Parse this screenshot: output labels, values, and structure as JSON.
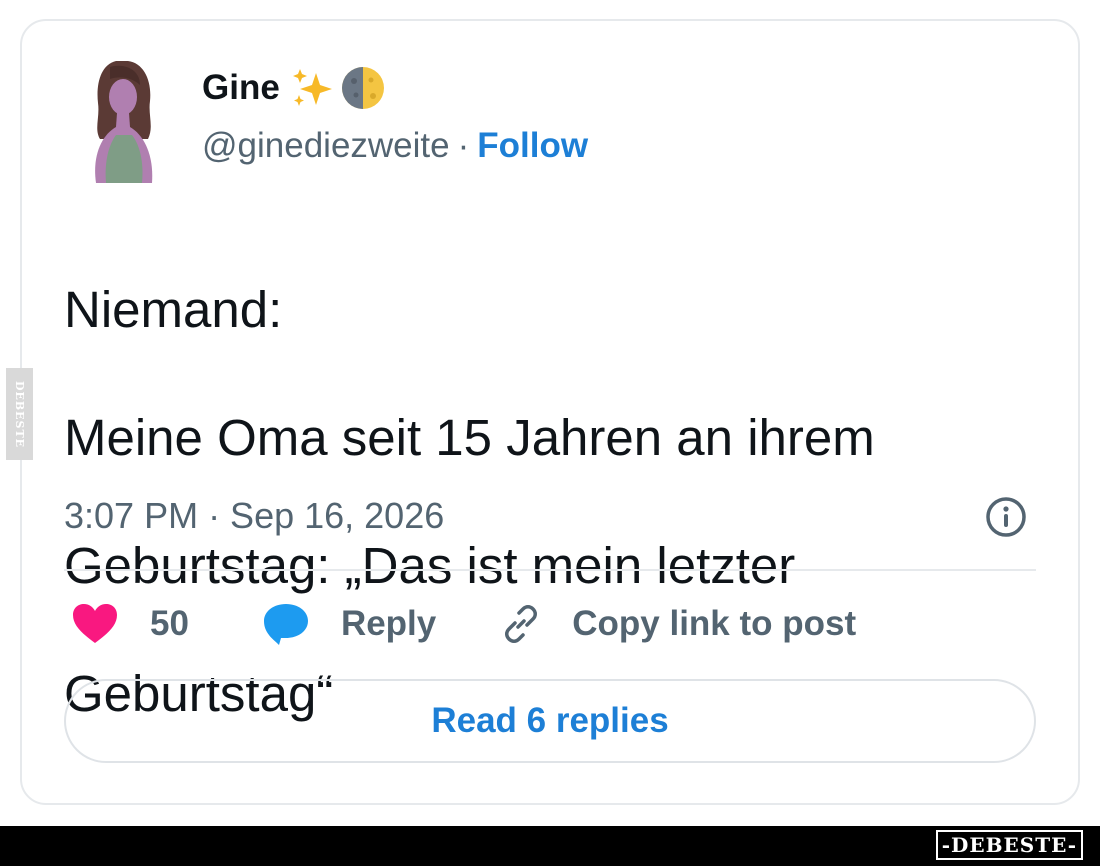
{
  "tweet": {
    "author_name": "Gine",
    "name_emojis": [
      "sparkles-icon",
      "moon-last-quarter-icon"
    ],
    "handle": "@ginediezweite",
    "separator": "·",
    "follow_label": "Follow",
    "text_lines": [
      "Niemand:",
      "Meine Oma seit 15 Jahren an ihrem",
      "Geburtstag: „Das ist mein letzter",
      "Geburtstag“"
    ],
    "timestamp": "3:07 PM · Sep 16, 2026"
  },
  "actions": {
    "like_count": "50",
    "reply_label": "Reply",
    "copy_label": "Copy link to post"
  },
  "read_replies_label": "Read 6 replies",
  "watermark": {
    "side_text": "DEBESTE",
    "brand_text": "-DEBESTE-"
  },
  "colors": {
    "link_blue": "#1d7fd6",
    "heart_pink": "#f91880",
    "reply_bubble_blue": "#1d9bf0",
    "secondary_text": "#536471"
  }
}
